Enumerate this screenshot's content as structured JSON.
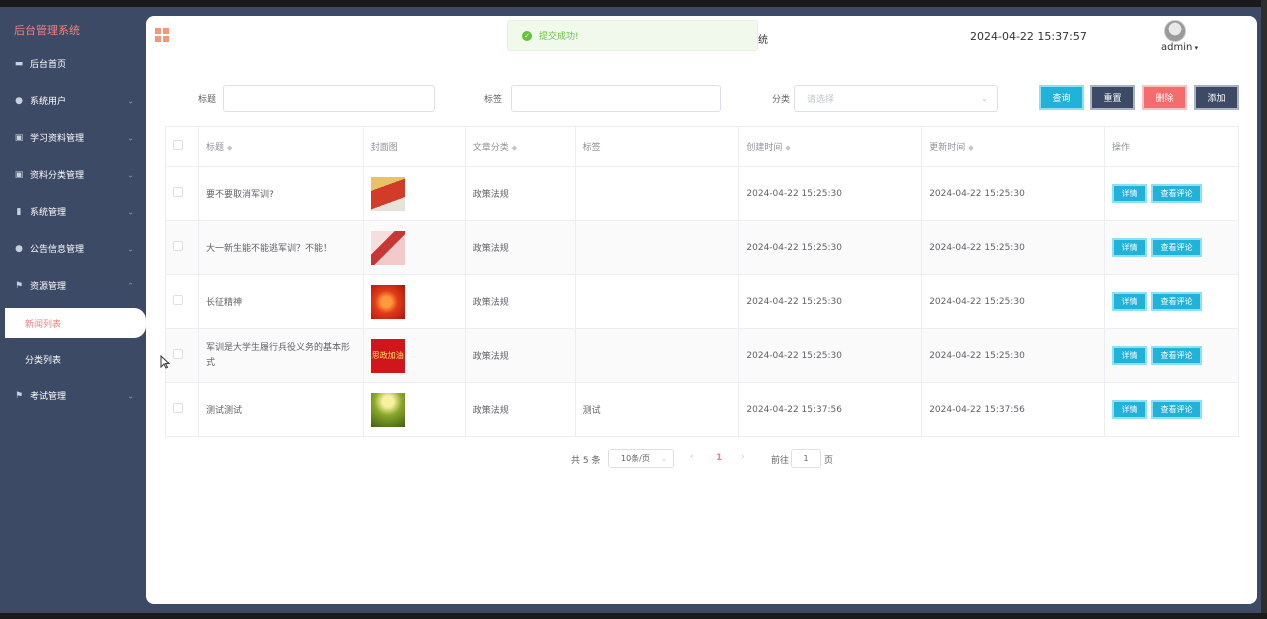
{
  "app": {
    "brand": "后台管理系统",
    "system_title_fragment": "统"
  },
  "header": {
    "datetime": "2024-04-22 15:37:57",
    "user": "admin"
  },
  "toast": {
    "message": "提交成功!"
  },
  "sidebar": {
    "items": [
      {
        "label": "后台首页",
        "icon": "monitor-icon"
      },
      {
        "label": "系统用户",
        "icon": "user-icon"
      },
      {
        "label": "学习资料管理",
        "icon": "doc-icon"
      },
      {
        "label": "资料分类管理",
        "icon": "check-doc-icon"
      },
      {
        "label": "系统管理",
        "icon": "bar-chart-icon"
      },
      {
        "label": "公告信息管理",
        "icon": "info-icon"
      },
      {
        "label": "资源管理",
        "icon": "flag-icon",
        "expanded": true
      },
      {
        "label": "考试管理",
        "icon": "flag-icon"
      }
    ],
    "sub_items": [
      {
        "label": "新闻列表",
        "active": true
      },
      {
        "label": "分类列表"
      }
    ]
  },
  "filters": {
    "title_label": "标题",
    "tag_label": "标签",
    "category_label": "分类",
    "category_placeholder": "请选择",
    "buttons": {
      "query": "查询",
      "reset": "重置",
      "delete": "删除",
      "add": "添加"
    }
  },
  "table": {
    "headers": [
      "标题",
      "封面图",
      "文章分类",
      "标签",
      "创建时间",
      "更新时间",
      "操作"
    ],
    "rows": [
      {
        "title": "要不要取消军训?",
        "category": "政策法规",
        "tag": "",
        "created": "2024-04-22 15:25:30",
        "updated": "2024-04-22 15:25:30"
      },
      {
        "title": "大一新生能不能逃军训？不能！",
        "category": "政策法规",
        "tag": "",
        "created": "2024-04-22 15:25:30",
        "updated": "2024-04-22 15:25:30"
      },
      {
        "title": "长征精神",
        "category": "政策法规",
        "tag": "",
        "created": "2024-04-22 15:25:30",
        "updated": "2024-04-22 15:25:30"
      },
      {
        "title": "军训是大学生履行兵役义务的基本形式",
        "category": "政策法规",
        "tag": "",
        "created": "2024-04-22 15:25:30",
        "updated": "2024-04-22 15:25:30",
        "cover_text": "思政加油"
      },
      {
        "title": "测试测试",
        "category": "政策法规",
        "tag": "测试",
        "created": "2024-04-22 15:37:56",
        "updated": "2024-04-22 15:37:56"
      }
    ],
    "action_detail": "详情",
    "action_comments": "查看评论"
  },
  "pagination": {
    "total": "共 5 条",
    "page_size": "10条/页",
    "prev": "‹",
    "current": "1",
    "next": "›",
    "goto_prefix": "前往",
    "goto_value": "1",
    "goto_suffix": "页"
  }
}
